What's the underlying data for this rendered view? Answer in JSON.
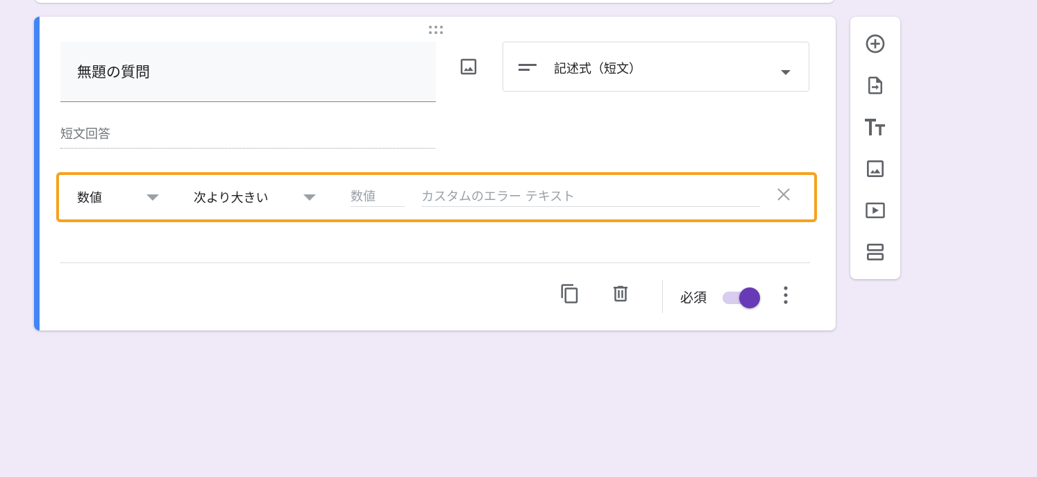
{
  "question": {
    "title": "無題の質問",
    "type_label": "記述式（短文）",
    "answer_placeholder": "短文回答"
  },
  "validation": {
    "type_value": "数値",
    "condition_value": "次より大きい",
    "number_placeholder": "数値",
    "error_placeholder": "カスタムのエラー テキスト"
  },
  "footer": {
    "required_label": "必須",
    "required_on": true
  },
  "colors": {
    "accent": "#4285f4",
    "highlight": "#f6a21e",
    "toggle": "#673ab7",
    "background": "#efe9f8"
  },
  "toolbar": {
    "items": [
      "add-question-icon",
      "import-questions-icon",
      "add-title-icon",
      "add-image-icon",
      "add-video-icon",
      "add-section-icon"
    ]
  }
}
